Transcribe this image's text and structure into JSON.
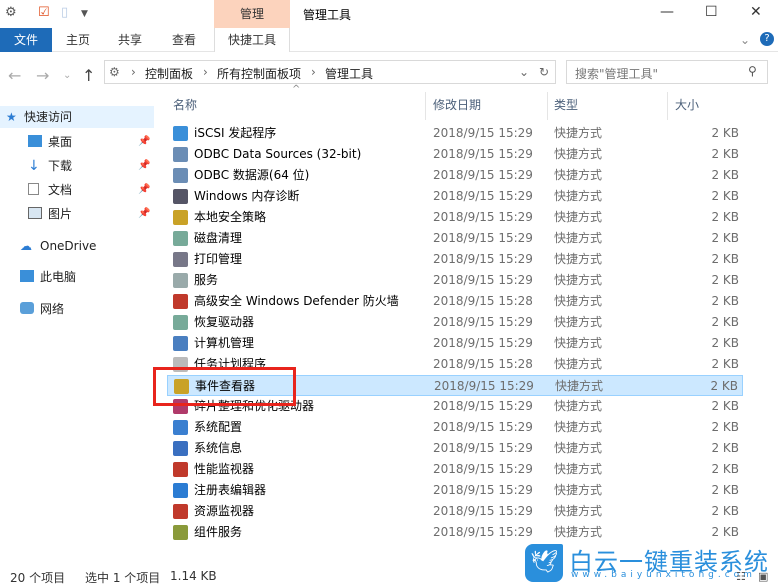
{
  "window": {
    "title": "管理工具",
    "context_tab_group": "管理"
  },
  "ribbon": {
    "tabs": [
      "文件",
      "主页",
      "共享",
      "查看",
      "快捷工具"
    ]
  },
  "address": {
    "crumbs": [
      "控制面板",
      "所有控制面板项",
      "管理工具"
    ],
    "search_placeholder": "搜索\"管理工具\""
  },
  "sidebar": {
    "items": [
      {
        "label": "快速访问",
        "icon": "star-icon"
      },
      {
        "label": "桌面",
        "icon": "desktop-icon"
      },
      {
        "label": "下载",
        "icon": "download-icon"
      },
      {
        "label": "文档",
        "icon": "document-icon"
      },
      {
        "label": "图片",
        "icon": "picture-icon"
      },
      {
        "label": "OneDrive",
        "icon": "cloud-icon"
      },
      {
        "label": "此电脑",
        "icon": "computer-icon"
      },
      {
        "label": "网络",
        "icon": "network-icon"
      }
    ]
  },
  "columns": {
    "name": "名称",
    "date": "修改日期",
    "type": "类型",
    "size": "大小"
  },
  "files": [
    {
      "name": "iSCSI 发起程序",
      "date": "2018/9/15 15:29",
      "type": "快捷方式",
      "size": "2 KB"
    },
    {
      "name": "ODBC Data Sources (32-bit)",
      "date": "2018/9/15 15:29",
      "type": "快捷方式",
      "size": "2 KB"
    },
    {
      "name": "ODBC 数据源(64 位)",
      "date": "2018/9/15 15:29",
      "type": "快捷方式",
      "size": "2 KB"
    },
    {
      "name": "Windows 内存诊断",
      "date": "2018/9/15 15:29",
      "type": "快捷方式",
      "size": "2 KB"
    },
    {
      "name": "本地安全策略",
      "date": "2018/9/15 15:29",
      "type": "快捷方式",
      "size": "2 KB"
    },
    {
      "name": "磁盘清理",
      "date": "2018/9/15 15:29",
      "type": "快捷方式",
      "size": "2 KB"
    },
    {
      "name": "打印管理",
      "date": "2018/9/15 15:29",
      "type": "快捷方式",
      "size": "2 KB"
    },
    {
      "name": "服务",
      "date": "2018/9/15 15:29",
      "type": "快捷方式",
      "size": "2 KB"
    },
    {
      "name": "高级安全 Windows Defender 防火墙",
      "date": "2018/9/15 15:28",
      "type": "快捷方式",
      "size": "2 KB"
    },
    {
      "name": "恢复驱动器",
      "date": "2018/9/15 15:29",
      "type": "快捷方式",
      "size": "2 KB"
    },
    {
      "name": "计算机管理",
      "date": "2018/9/15 15:29",
      "type": "快捷方式",
      "size": "2 KB"
    },
    {
      "name": "任务计划程序",
      "date": "2018/9/15 15:28",
      "type": "快捷方式",
      "size": "2 KB"
    },
    {
      "name": "事件查看器",
      "date": "2018/9/15 15:29",
      "type": "快捷方式",
      "size": "2 KB",
      "selected": true
    },
    {
      "name": "碎片整理和优化驱动器",
      "date": "2018/9/15 15:29",
      "type": "快捷方式",
      "size": "2 KB"
    },
    {
      "name": "系统配置",
      "date": "2018/9/15 15:29",
      "type": "快捷方式",
      "size": "2 KB"
    },
    {
      "name": "系统信息",
      "date": "2018/9/15 15:29",
      "type": "快捷方式",
      "size": "2 KB"
    },
    {
      "name": "性能监视器",
      "date": "2018/9/15 15:29",
      "type": "快捷方式",
      "size": "2 KB"
    },
    {
      "name": "注册表编辑器",
      "date": "2018/9/15 15:29",
      "type": "快捷方式",
      "size": "2 KB"
    },
    {
      "name": "资源监视器",
      "date": "2018/9/15 15:29",
      "type": "快捷方式",
      "size": "2 KB"
    },
    {
      "name": "组件服务",
      "date": "2018/9/15 15:29",
      "type": "快捷方式",
      "size": "2 KB"
    }
  ],
  "status": {
    "count": "20 个项目",
    "selected": "选中 1 个项目",
    "size": "1.14 KB"
  },
  "watermark": {
    "brand": "白云一键重装系统",
    "url": "www.baiyunxitong.com"
  },
  "colors": {
    "accent": "#1e6bb8",
    "selection": "#cce8ff",
    "highlight_box": "#e8241c",
    "context_tab": "#fcd3bd"
  }
}
